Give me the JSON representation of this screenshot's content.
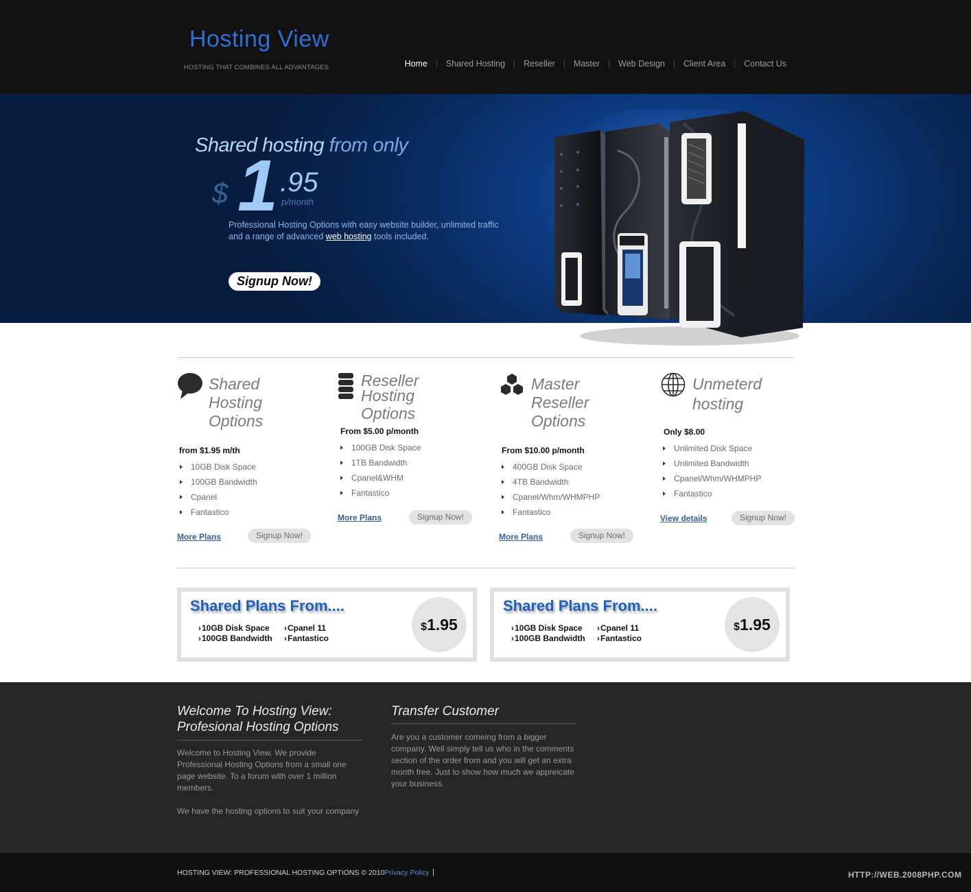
{
  "colors": {
    "header_bg": "#111111",
    "accent_blue": "#2f6fd6",
    "hero_blue": "#0c3a80",
    "footer_bg": "#262626",
    "bottom_bar_bg": "#101010"
  },
  "header": {
    "logo_title": "Hosting View",
    "logo_tagline": "HOSTING THAT COMBINES ALL ADVANTAGES",
    "nav": [
      "Home",
      "Shared Hosting",
      "Reseller",
      "Master",
      "Web Design",
      "Client Area",
      "Contact Us"
    ],
    "nav_active": "Home"
  },
  "hero": {
    "headline_bright": "Shared hosting",
    "headline_dim": "from only",
    "currency": "$",
    "price_int": "1",
    "price_dec": ".95",
    "price_per": "p/month",
    "desc_line1": "Professional Hosting Options with easy website builder, unlimited traffic",
    "desc_prefix": "and a range of advanced",
    "desc_link": "web hosting",
    "desc_suffix": "tools included.",
    "signup_label": "Signup Now!",
    "graphic_icon": "server-towers-image"
  },
  "plans": [
    {
      "icon": "speech-bubble-icon",
      "title_lines": [
        "Shared",
        "Hosting",
        "Options"
      ],
      "price": "from $1.95 m/th",
      "features": [
        "10GB Disk Space",
        "100GB Bandwidth",
        "Cpanel",
        "Fantastico"
      ],
      "link_label": "More Plans",
      "button_label": "Signup Now!"
    },
    {
      "icon": "server-stack-icon",
      "title_lines": [
        "Reseller",
        "Hosting",
        "Options"
      ],
      "price": "From $5.00 p/month",
      "features": [
        "100GB Disk Space",
        "1TB Bandwidth",
        "Cpanel&WHM",
        "Fantastico"
      ],
      "link_label": "More Plans",
      "button_label": "Signup Now!"
    },
    {
      "icon": "hexagons-icon",
      "title_lines": [
        "Master",
        "Reseller",
        "Options"
      ],
      "price": "From $10.00 p/month",
      "features": [
        "400GB Disk Space",
        "4TB Bandwidth",
        "Cpanel/Whm/WHMPHP",
        "Fantastico"
      ],
      "link_label": "More Plans",
      "button_label": "Signup Now!"
    },
    {
      "icon": "globe-icon",
      "title_lines": [
        "Unmeterd",
        "hosting"
      ],
      "price": "Only $8.00",
      "features": [
        "Unlimited Disk Space",
        "Unlimited Bandwidth",
        "Cpanel/Whm/WHMPHP",
        "Fantastico"
      ],
      "link_label": "View details",
      "button_label": "Signup Now!"
    }
  ],
  "banners": [
    {
      "title": "Shared Plans From....",
      "features": [
        "10GB Disk Space",
        "100GB Bandwidth",
        "Cpanel 11",
        "Fantastico"
      ],
      "currency": "$",
      "price": "1.95"
    },
    {
      "title": "Shared Plans From....",
      "features": [
        "10GB Disk Space",
        "100GB Bandwidth",
        "Cpanel 11",
        "Fantastico"
      ],
      "currency": "$",
      "price": "1.95"
    }
  ],
  "footer": {
    "welcome_heading_line1": "Welcome To Hosting View:",
    "welcome_heading_line2": "Profesional Hosting Options",
    "welcome_p1": "Welcome to Hosting View. We provide Professional Hosting Options from a small one page website. To a forum with over 1 million members.",
    "welcome_p2": "We have the hosting options to suit your company",
    "transfer_heading": "Transfer Customer",
    "transfer_p": " Are you a customer comeing from a bigger company. Well simply tell us who in the comments section of the order from and you will get an extra month free. Just to show how much we appreicate your business.",
    "copyright": "HOSTING VIEW: PROFESSIONAL HOSTING OPTIONS © 2010",
    "privacy_link": "Privacy Policy",
    "privacy_separator": "|",
    "watermark": "HTTP://WEB.2008PHP.COM"
  }
}
